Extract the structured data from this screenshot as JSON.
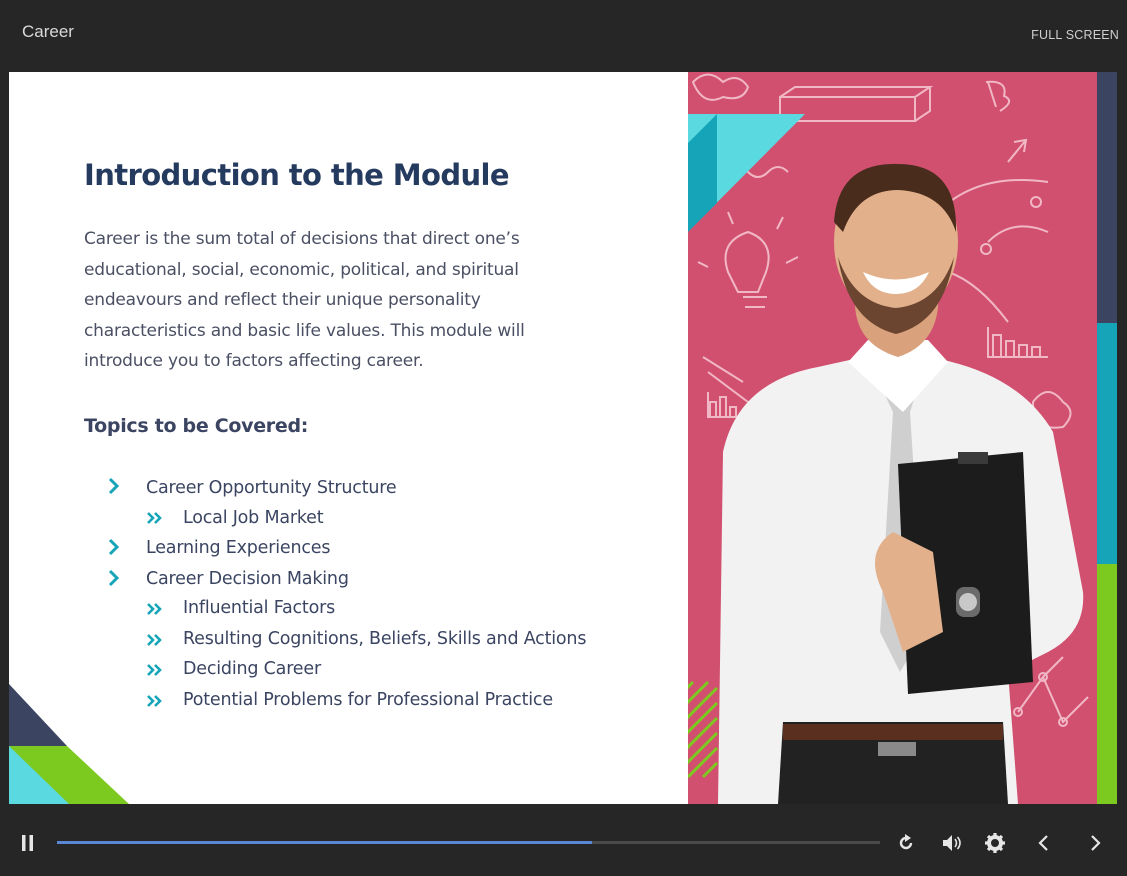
{
  "app": {
    "title": "Career",
    "fullscreen_label": "FULL SCREEN"
  },
  "slide": {
    "heading": "Introduction to the Module",
    "paragraph": "Career is the sum total of decisions that direct one’s educational, social, economic, political, and spiritual endeavours and reflect their unique personality characteristics and basic life values.  This module will introduce you to factors affecting career.",
    "topics_heading": "Topics to be Covered:",
    "topics": [
      {
        "label": "Career Opportunity Structure",
        "level": 1
      },
      {
        "label": "Local Job Market",
        "level": 2
      },
      {
        "label": "Learning Experiences",
        "level": 1
      },
      {
        "label": "Career Decision Making",
        "level": 1
      },
      {
        "label": "Influential Factors",
        "level": 2
      },
      {
        "label": "Resulting Cognitions, Beliefs, Skills and Actions",
        "level": 2
      },
      {
        "label": "Deciding Career",
        "level": 2
      },
      {
        "label": "Potential Problems for Professional Practice",
        "level": 2
      }
    ]
  },
  "player": {
    "progress": 0.65,
    "buttons": [
      "pause-icon",
      "replay-icon",
      "volume-icon",
      "settings-icon",
      "prev-icon",
      "next-icon"
    ]
  },
  "colors": {
    "heading": "#243a5e",
    "teal": "#16a5b8",
    "light_teal": "#5ad9e0",
    "green": "#7cc91f",
    "navy": "#3b4562",
    "pink": "#d2506f",
    "progress": "#5b86d6"
  }
}
